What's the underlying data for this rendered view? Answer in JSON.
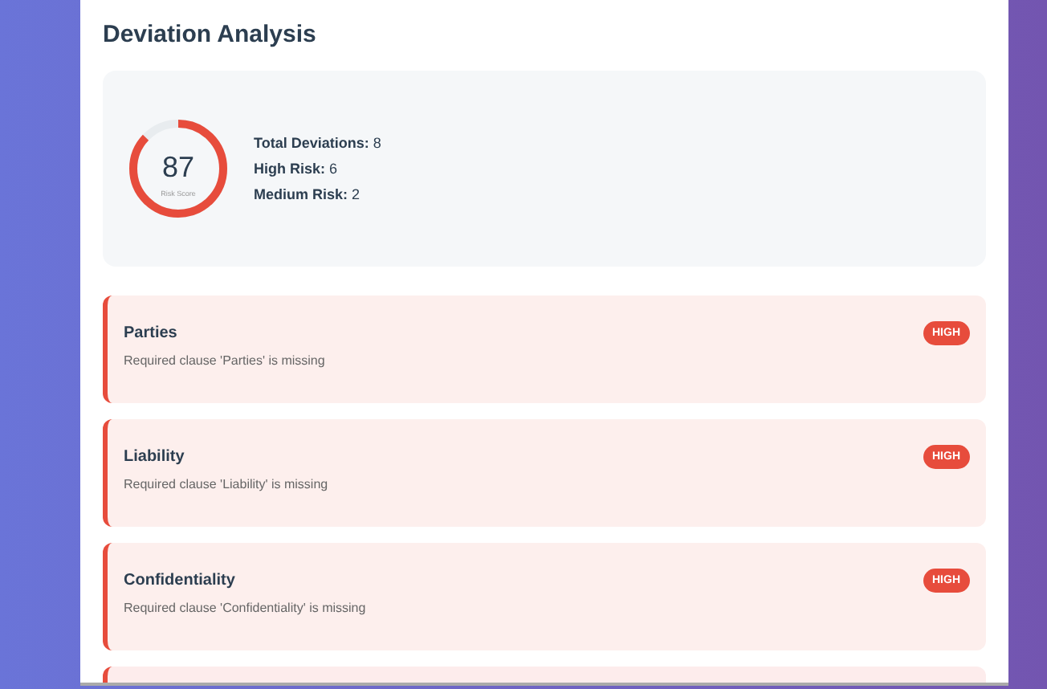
{
  "title": "Deviation Analysis",
  "summary": {
    "score": "87",
    "score_label": "Risk Score",
    "stats": [
      {
        "label": "Total Deviations:",
        "value": "8"
      },
      {
        "label": "High Risk:",
        "value": "6"
      },
      {
        "label": "Medium Risk:",
        "value": "2"
      }
    ]
  },
  "deviations": [
    {
      "title": "Parties",
      "description": "Required clause 'Parties' is missing",
      "color": "#e74c3c",
      "badge": "HIGH"
    },
    {
      "title": "Liability",
      "description": "Required clause 'Liability' is missing",
      "color": "#e74c3c",
      "badge": "HIGH"
    },
    {
      "title": "Confidentiality",
      "description": "Required clause 'Confidentiality' is missing",
      "color": "#e74c3c",
      "badge": "HIGH"
    }
  ]
}
